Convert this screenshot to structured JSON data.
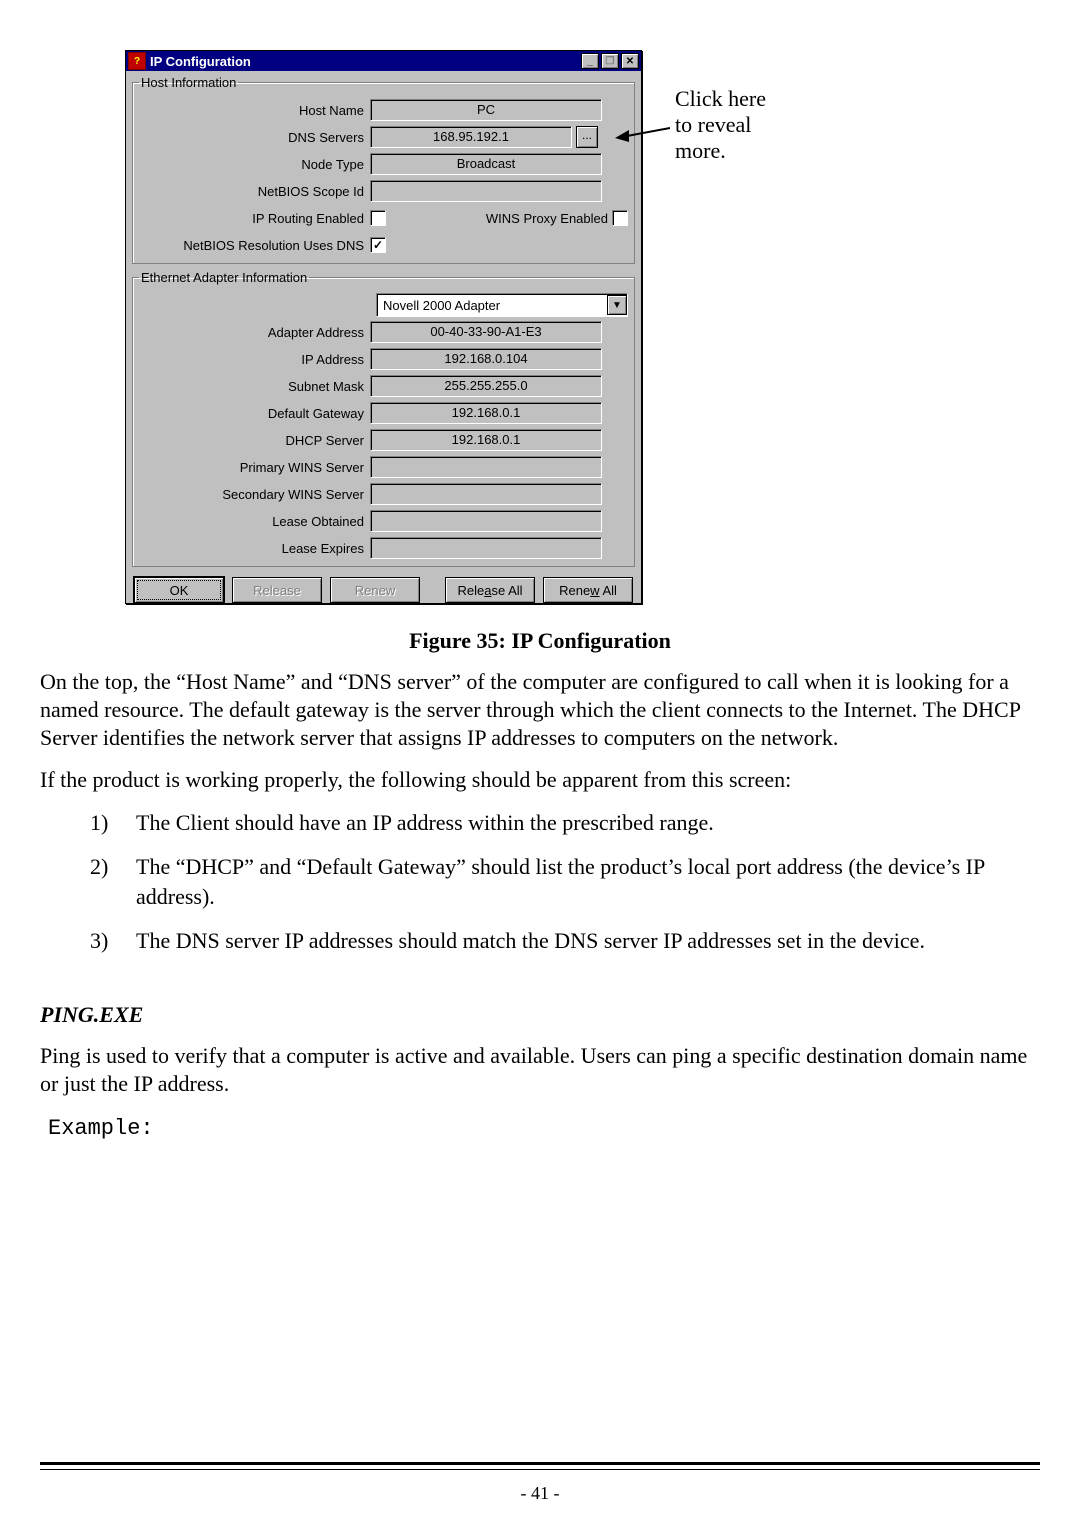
{
  "window": {
    "title": "IP Configuration",
    "minimize_glyph": "_",
    "restore_glyph": "❐",
    "close_glyph": "✕"
  },
  "host_info": {
    "legend": "Host Information",
    "host_name_label": "Host Name",
    "host_name_value": "PC",
    "dns_label": "DNS Servers",
    "dns_value": "168.95.192.1",
    "dns_more_label": "...",
    "node_type_label": "Node Type",
    "node_type_value": "Broadcast",
    "netbios_scope_label": "NetBIOS Scope Id",
    "netbios_scope_value": "",
    "ip_routing_label": "IP Routing Enabled",
    "ip_routing_checked": false,
    "wins_proxy_label": "WINS Proxy Enabled",
    "wins_proxy_checked": false,
    "netbios_dns_label": "NetBIOS Resolution Uses DNS",
    "netbios_dns_checked": true
  },
  "adapter_info": {
    "legend": "Ethernet Adapter Information",
    "adapter_selected": "Novell 2000 Adapter",
    "rows": [
      {
        "label": "Adapter Address",
        "value": "00-40-33-90-A1-E3"
      },
      {
        "label": "IP Address",
        "value": "192.168.0.104"
      },
      {
        "label": "Subnet Mask",
        "value": "255.255.255.0"
      },
      {
        "label": "Default Gateway",
        "value": "192.168.0.1"
      },
      {
        "label": "DHCP Server",
        "value": "192.168.0.1"
      },
      {
        "label": "Primary WINS Server",
        "value": ""
      },
      {
        "label": "Secondary WINS Server",
        "value": ""
      },
      {
        "label": "Lease Obtained",
        "value": ""
      },
      {
        "label": "Lease Expires",
        "value": ""
      }
    ]
  },
  "buttons": {
    "ok": "OK",
    "release": "Release",
    "renew": "Renew",
    "release_all": "Release All",
    "renew_all": "Renew All"
  },
  "annotation": {
    "line1": "Click here",
    "line2": "to reveal",
    "line3": "more."
  },
  "caption": "Figure 35: IP Configuration",
  "para1": "On the top, the “Host Name” and “DNS server” of the computer are configured to call when it is looking for a named resource. The default gateway is the server through which the client connects to the Internet. The DHCP Server identifies the network server that assigns IP addresses to computers on the network.",
  "para2": "If the product is working properly, the following should be apparent from this screen:",
  "list": [
    "The Client should have an IP address within the prescribed range.",
    " The “DHCP” and “Default Gateway” should list the product’s local port address (the device’s IP address).",
    "The DNS server IP addresses should match the DNS server IP addresses set in the device."
  ],
  "ping_heading": "PING.EXE",
  "ping_para": "Ping is used to verify that a computer is active and available. Users can ping a specific destination domain name or just the IP address.",
  "example_label": "Example:",
  "page_number": "- 41 -"
}
